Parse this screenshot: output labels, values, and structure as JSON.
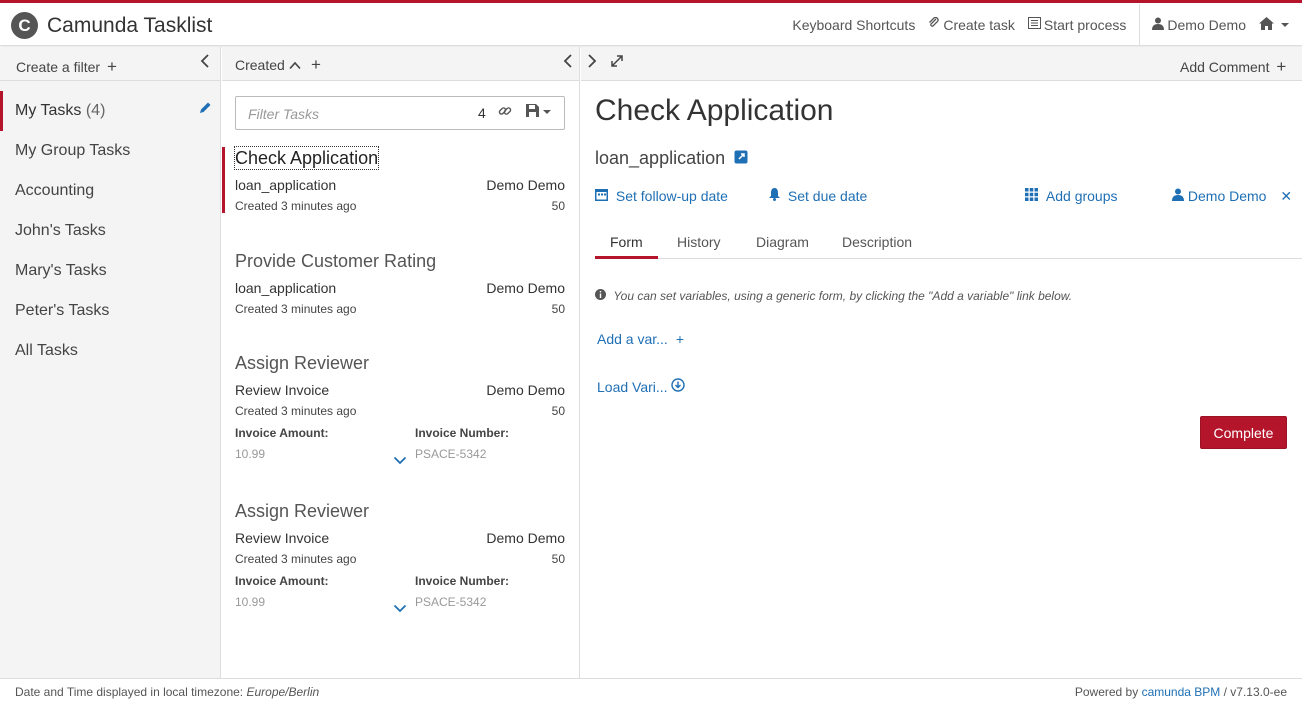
{
  "header": {
    "logo_letter": "C",
    "title": "Camunda Tasklist",
    "nav": {
      "keyboard": "Keyboard Shortcuts",
      "create_task": "Create task",
      "start_process": "Start process",
      "user": "Demo Demo"
    }
  },
  "filters": {
    "create_label": "Create a filter",
    "items": [
      {
        "label": "My Tasks",
        "count": "(4)"
      },
      {
        "label": "My Group Tasks"
      },
      {
        "label": "Accounting"
      },
      {
        "label": "John's Tasks"
      },
      {
        "label": "Mary's Tasks"
      },
      {
        "label": "Peter's Tasks"
      },
      {
        "label": "All Tasks"
      }
    ]
  },
  "list": {
    "sort_label": "Created",
    "search": {
      "placeholder": "Filter Tasks",
      "count": "4"
    },
    "tasks": [
      {
        "name": "Check Application",
        "process": "loan_application",
        "assignee": "Demo Demo",
        "created": "Created 3 minutes ago",
        "priority": "50"
      },
      {
        "name": "Provide Customer Rating",
        "process": "loan_application",
        "assignee": "Demo Demo",
        "created": "Created 3 minutes ago",
        "priority": "50"
      },
      {
        "name": "Assign Reviewer",
        "process": "Review Invoice",
        "assignee": "Demo Demo",
        "created": "Created 3 minutes ago",
        "priority": "50",
        "var1_label": "Invoice Amount:",
        "var1_value": "10.99",
        "var2_label": "Invoice Number:",
        "var2_value": "PSACE-5342"
      },
      {
        "name": "Assign Reviewer",
        "process": "Review Invoice",
        "assignee": "Demo Demo",
        "created": "Created 3 minutes ago",
        "priority": "50",
        "var1_label": "Invoice Amount:",
        "var1_value": "10.99",
        "var2_label": "Invoice Number:",
        "var2_value": "PSACE-5342"
      }
    ]
  },
  "detail": {
    "add_comment": "Add Comment",
    "title": "Check Application",
    "process": "loan_application",
    "follow_up": "Set follow-up date",
    "due_date": "Set due date",
    "add_groups": "Add groups",
    "assignee": "Demo Demo",
    "tabs": [
      "Form",
      "History",
      "Diagram",
      "Description"
    ],
    "note": "You can set variables, using a generic form, by clicking the \"Add a variable\" link below.",
    "add_variable": "Add a var...",
    "load_variables": "Load Vari...",
    "complete": "Complete"
  },
  "footer": {
    "timezone_prefix": "Date and Time displayed in local timezone:",
    "timezone": "Europe/Berlin",
    "powered_by": "Powered by",
    "product": "camunda BPM",
    "version": "/ v7.13.0-ee"
  }
}
